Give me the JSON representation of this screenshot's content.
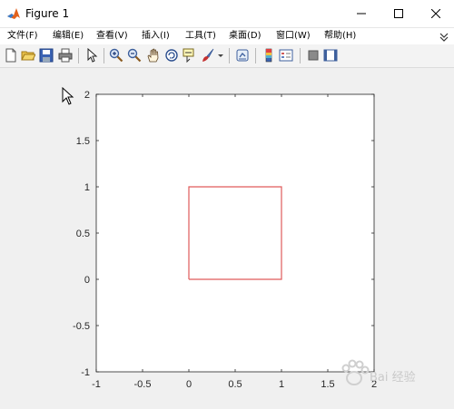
{
  "window": {
    "title": "Figure 1",
    "icon": "matlab-icon",
    "controls": [
      "minimize-icon",
      "maximize-icon",
      "close-icon"
    ]
  },
  "menu": {
    "items": [
      "文件(F)",
      "编辑(E)",
      "查看(V)",
      "插入(I)",
      "工具(T)",
      "桌面(D)",
      "窗口(W)",
      "帮助(H)"
    ]
  },
  "toolbar": {
    "buttons": [
      "new-figure-icon",
      "open-file-icon",
      "save-icon",
      "print-icon",
      "edit-plot-arrow-icon",
      "zoom-in-icon",
      "zoom-out-icon",
      "pan-hand-icon",
      "rotate-3d-icon",
      "data-cursor-icon",
      "brush-icon",
      "brush-dropdown-icon",
      "link-plot-icon",
      "colorbar-icon",
      "legend-icon",
      "hide-plot-tools-icon",
      "show-plot-tools-icon"
    ]
  },
  "chart_data": {
    "type": "line",
    "title": "",
    "xlabel": "",
    "ylabel": "",
    "xlim": [
      -1,
      2
    ],
    "ylim": [
      -1,
      2
    ],
    "xticks": [
      "-1",
      "-0.5",
      "0",
      "0.5",
      "1",
      "1.5",
      "2"
    ],
    "yticks": [
      "-1",
      "-0.5",
      "0",
      "0.5",
      "1",
      "1.5",
      "2"
    ],
    "grid": false,
    "series": [
      {
        "x": [
          0,
          1,
          1,
          0,
          0
        ],
        "y": [
          0,
          0,
          1,
          1,
          0
        ],
        "color": "#e05a5a"
      }
    ]
  },
  "watermark": {
    "text": "Bai 经验",
    "color": "#c9c9c9"
  }
}
